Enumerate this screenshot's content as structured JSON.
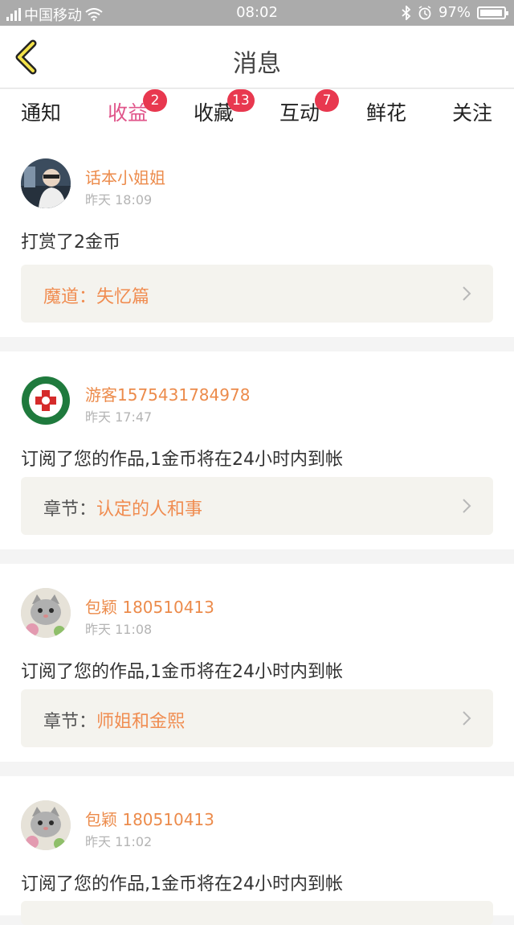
{
  "status_bar": {
    "carrier": "中国移动",
    "time": "08:02",
    "battery": "97%",
    "battery_level": 0.97
  },
  "header": {
    "title": "消息"
  },
  "tabs": [
    {
      "label": "通知",
      "badge": ""
    },
    {
      "label": "收益",
      "badge": "2"
    },
    {
      "label": "收藏",
      "badge": "13"
    },
    {
      "label": "互动",
      "badge": "7"
    },
    {
      "label": "鲜花",
      "badge": ""
    },
    {
      "label": "关注",
      "badge": ""
    }
  ],
  "active_tab": "收益",
  "colors": {
    "accent": "#e0558a",
    "badge": "#e8384f",
    "username": "#ec8b4b",
    "status_bar": "#ababab"
  },
  "messages": [
    {
      "user": "话本小姐姐",
      "time": "昨天 18:09",
      "text": "打赏了2金币",
      "ref_prefix": "魔道：",
      "ref_title": "失忆篇",
      "avatar_icon": "person-avatar-icon"
    },
    {
      "user": "游客1575431784978",
      "time": "昨天 17:47",
      "text": "订阅了您的作品,1金币将在24小时内到帐",
      "ref_prefix": "章节：",
      "ref_title": "认定的人和事",
      "avatar_icon": "green-emblem-avatar-icon"
    },
    {
      "user": "包颖 180510413",
      "time": "昨天 11:08",
      "text": "订阅了您的作品,1金币将在24小时内到帐",
      "ref_prefix": "章节：",
      "ref_title": "师姐和金熙",
      "avatar_icon": "kitten-avatar-icon"
    },
    {
      "user": "包颖 180510413",
      "time": "昨天 11:02",
      "text": "订阅了您的作品,1金币将在24小时内到帐",
      "ref_prefix": "",
      "ref_title": "",
      "avatar_icon": "kitten-avatar-icon"
    }
  ]
}
